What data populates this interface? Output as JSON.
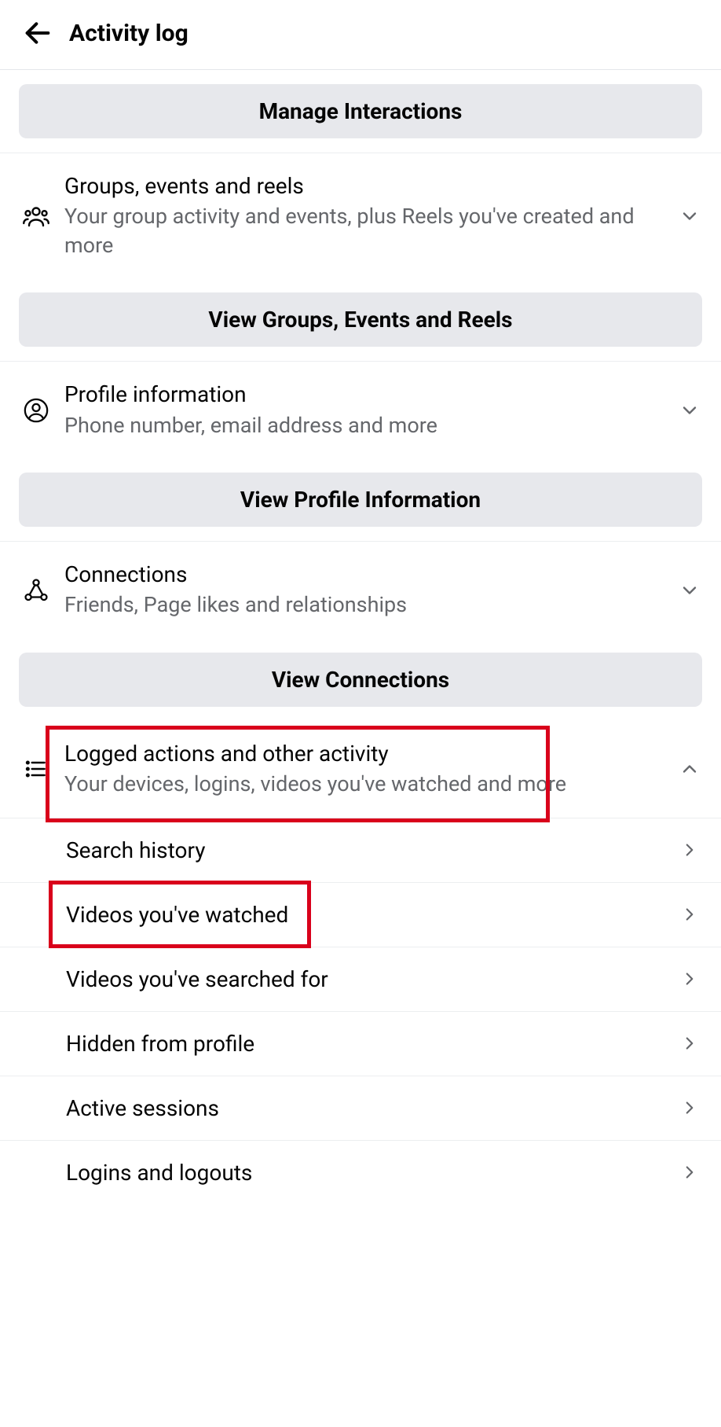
{
  "header": {
    "title": "Activity log"
  },
  "buttons": {
    "manage_interactions": "Manage Interactions",
    "view_groups_events_reels": "View Groups, Events and Reels",
    "view_profile_information": "View Profile Information",
    "view_connections": "View Connections"
  },
  "sections": {
    "groups": {
      "title": "Groups, events and reels",
      "sub": "Your group activity and events, plus Reels you've created and more"
    },
    "profile": {
      "title": "Profile information",
      "sub": "Phone number, email address and more"
    },
    "connections": {
      "title": "Connections",
      "sub": "Friends, Page likes and relationships"
    },
    "logged": {
      "title": "Logged actions and other activity",
      "sub": "Your devices, logins, videos you've watched and more"
    }
  },
  "subitems": {
    "search_history": "Search history",
    "videos_watched": "Videos you've watched",
    "videos_searched": "Videos you've searched for",
    "hidden_from_profile": "Hidden from profile",
    "active_sessions": "Active sessions",
    "logins_logouts": "Logins and logouts"
  }
}
